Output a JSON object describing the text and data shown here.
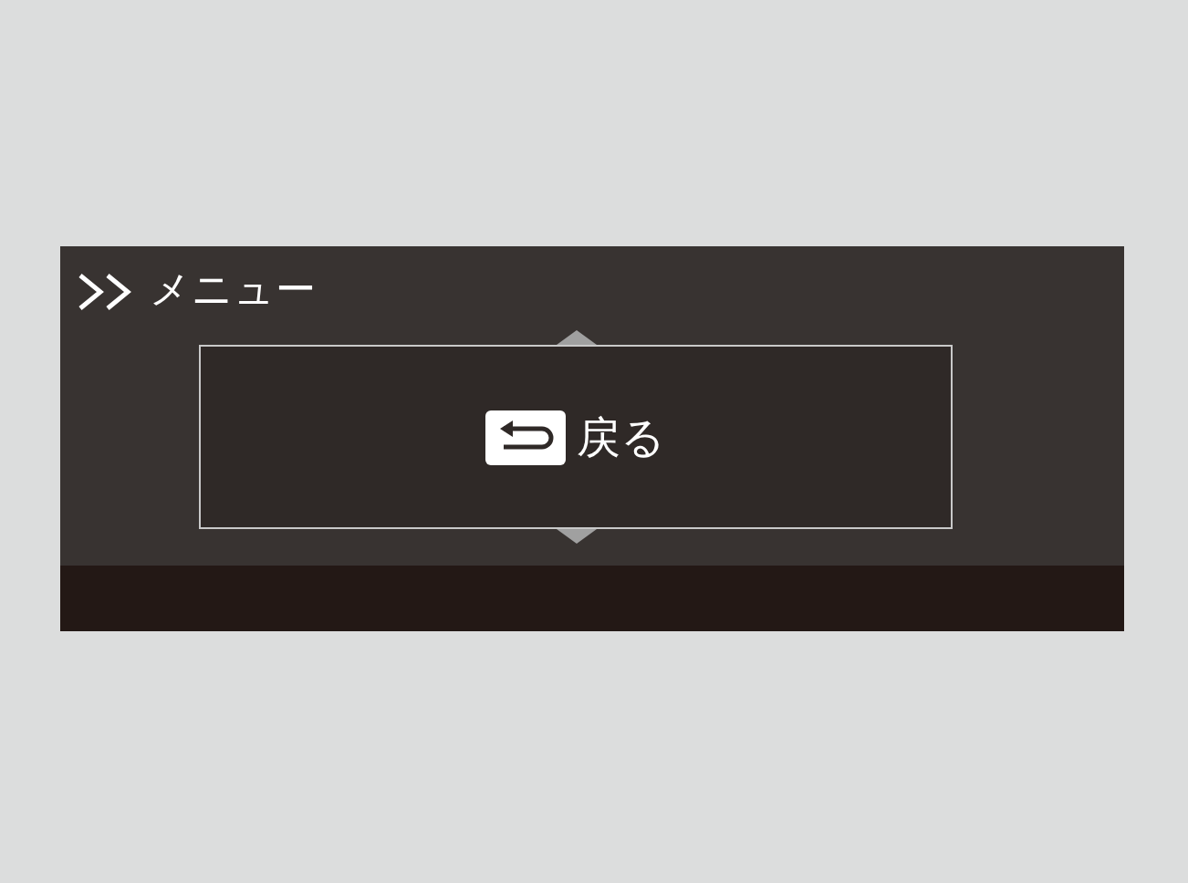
{
  "menu_screen": {
    "title": "メニュー",
    "items": [
      {
        "label": "戻る",
        "kind": "back",
        "selected": true
      }
    ]
  }
}
